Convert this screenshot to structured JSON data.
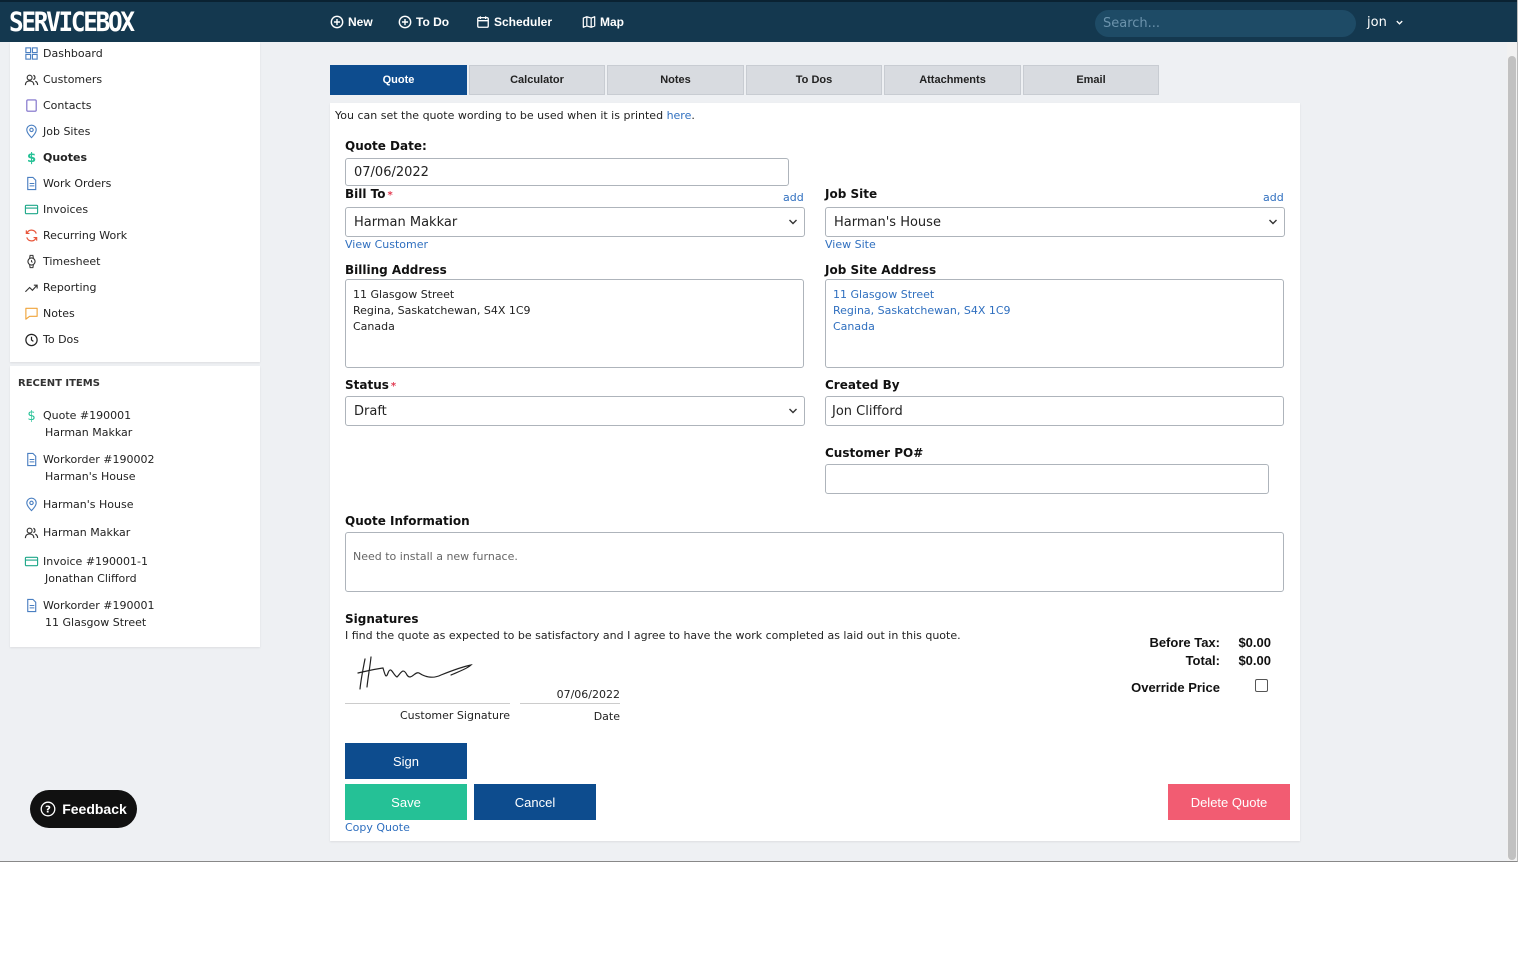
{
  "app": {
    "logo": "SERVICEBOX",
    "user": "jon"
  },
  "topnav": {
    "new": "New",
    "todo": "To Do",
    "scheduler": "Scheduler",
    "map": "Map",
    "search_placeholder": "Search..."
  },
  "sidebar": {
    "items": [
      {
        "label": "Dashboard",
        "icon": "dashboard-icon"
      },
      {
        "label": "Customers",
        "icon": "users-icon"
      },
      {
        "label": "Contacts",
        "icon": "contact-card-icon"
      },
      {
        "label": "Job Sites",
        "icon": "map-pin-icon"
      },
      {
        "label": "Quotes",
        "icon": "dollar-icon",
        "active": true
      },
      {
        "label": "Work Orders",
        "icon": "document-icon"
      },
      {
        "label": "Invoices",
        "icon": "credit-card-icon"
      },
      {
        "label": "Recurring Work",
        "icon": "recurring-icon"
      },
      {
        "label": "Timesheet",
        "icon": "watch-icon"
      },
      {
        "label": "Reporting",
        "icon": "trend-icon"
      },
      {
        "label": "Notes",
        "icon": "note-icon"
      },
      {
        "label": "To Dos",
        "icon": "clock-icon"
      }
    ]
  },
  "recent": {
    "title": "RECENT ITEMS",
    "items": [
      {
        "title": "Quote #190001",
        "sub": "Harman Makkar",
        "icon": "dollar-icon"
      },
      {
        "title": "Workorder #190002",
        "sub": "Harman's House",
        "icon": "document-icon"
      },
      {
        "title": "Harman's House",
        "sub": "",
        "icon": "map-pin-icon"
      },
      {
        "title": "Harman Makkar",
        "sub": "",
        "icon": "users-icon"
      },
      {
        "title": "Invoice #190001-1",
        "sub": "Jonathan Clifford",
        "icon": "credit-card-icon"
      },
      {
        "title": "Workorder #190001",
        "sub": "11 Glasgow Street",
        "icon": "document-icon"
      }
    ]
  },
  "feedback": {
    "label": "Feedback"
  },
  "tabs": [
    "Quote",
    "Calculator",
    "Notes",
    "To Dos",
    "Attachments",
    "Email"
  ],
  "form": {
    "intro_text": "You can set the quote wording to be used when it is printed ",
    "intro_link": "here",
    "intro_end": ".",
    "quote_date_label": "Quote Date:",
    "quote_date": "07/06/2022",
    "bill_to_label": "Bill To",
    "required_mark": "*",
    "add_link": "add",
    "bill_to": "Harman Makkar",
    "view_customer": "View Customer",
    "job_site_label": "Job Site",
    "job_site": "Harman's House",
    "view_site": "View Site",
    "billing_address_label": "Billing Address",
    "billing_address": [
      "11 Glasgow Street",
      "Regina, Saskatchewan, S4X 1C9",
      "Canada"
    ],
    "job_site_address_label": "Job Site Address",
    "job_site_address": [
      "11 Glasgow Street",
      "Regina, Saskatchewan, S4X 1C9",
      "Canada"
    ],
    "status_label": "Status",
    "status": "Draft",
    "created_by_label": "Created By",
    "created_by": "Jon Clifford",
    "customer_po_label": "Customer PO#",
    "customer_po": "",
    "quote_info_label": "Quote Information",
    "quote_info": "Need to install a new furnace.",
    "signatures_label": "Signatures",
    "signatures_text": "I find the quote as expected to be satisfactory and I agree to have the work completed as laid out in this quote.",
    "signature_date": "07/06/2022",
    "customer_signature_caption": "Customer Signature",
    "date_caption": "Date",
    "before_tax_label": "Before Tax:",
    "before_tax": "$0.00",
    "total_label": "Total:",
    "total": "$0.00",
    "override_price_label": "Override Price"
  },
  "buttons": {
    "sign": "Sign",
    "save": "Save",
    "cancel": "Cancel",
    "delete": "Delete Quote",
    "copy": "Copy Quote"
  },
  "colors": {
    "topbar": "#14384f",
    "primary": "#0d4c8e",
    "save": "#25c196",
    "delete": "#f25c72",
    "link": "#2f6fbf"
  }
}
